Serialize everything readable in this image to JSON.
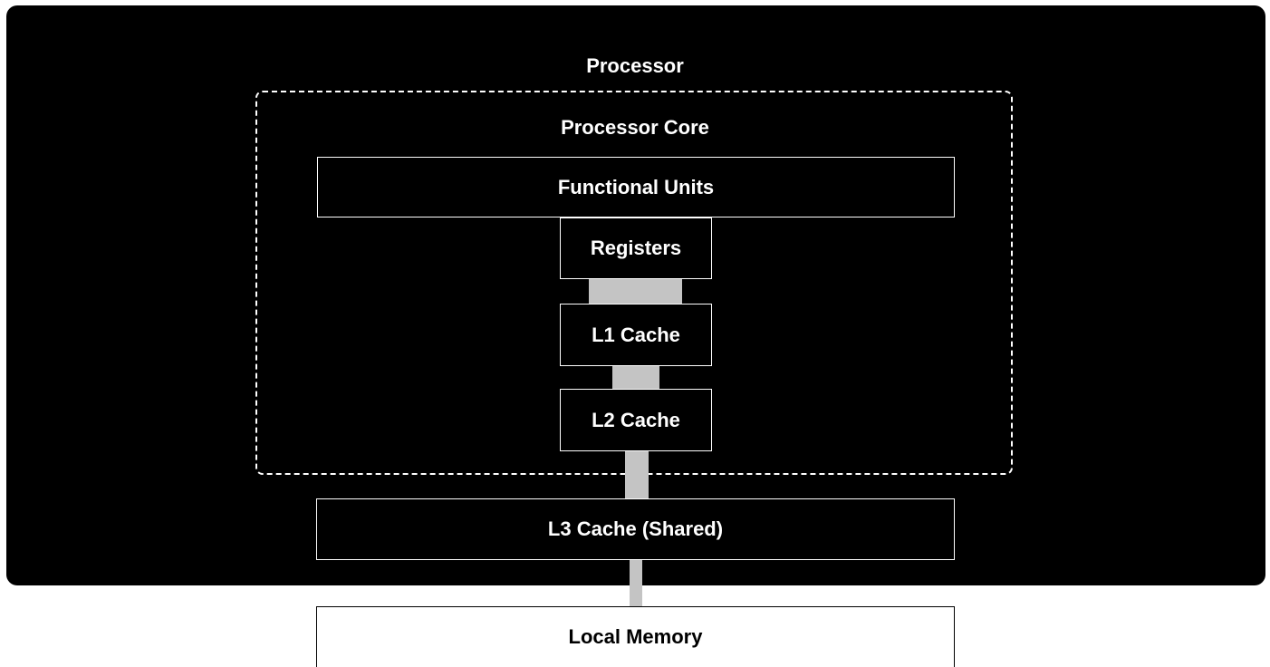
{
  "diagram": {
    "processor_label": "Processor",
    "core_label": "Processor Core",
    "functional_units": "Functional Units",
    "registers": "Registers",
    "l1_cache": "L1 Cache",
    "l2_cache": "L2 Cache",
    "l3_cache": "L3 Cache (Shared)",
    "local_memory": "Local Memory"
  },
  "colors": {
    "panel_background": "#000000",
    "box_border": "#ffffff",
    "connector": "#c4c4c4",
    "memory_background": "#ffffff"
  }
}
